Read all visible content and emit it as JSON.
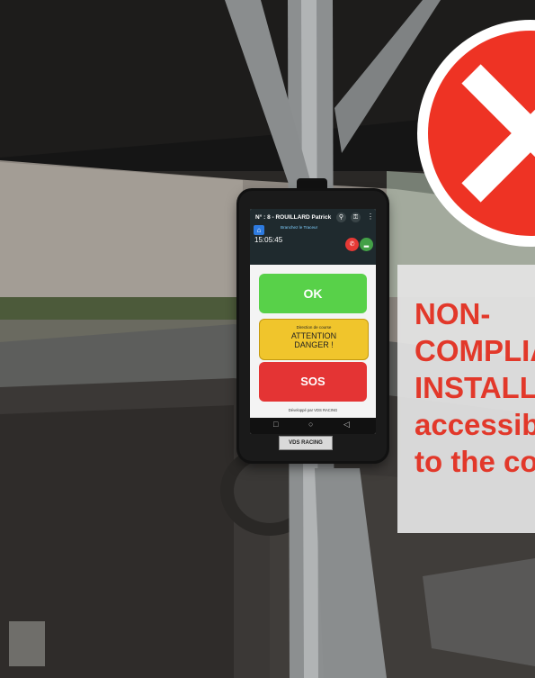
{
  "phone_app": {
    "header_title": "N° : 8 - ROUILLARD Patrick",
    "status_text": "Branchez le Traceur",
    "time": "15:05:45",
    "ok_label": "OK",
    "attention_caption": "Direction de course",
    "attention_label": "ATTENTION\nDANGER !",
    "sos_label": "SOS",
    "developed_by": "Développé par VDS RACING",
    "bezel_logo": "VDS RACING"
  },
  "warning_overlay": {
    "text": "NON-\nCOMPLIA\nINSTALL\naccessib\nto the co",
    "icon": "close-icon"
  },
  "colors": {
    "ok_green": "#58d149",
    "attention_yellow": "#f0c52c",
    "sos_red": "#e43434",
    "warning_red": "#e2382a"
  }
}
